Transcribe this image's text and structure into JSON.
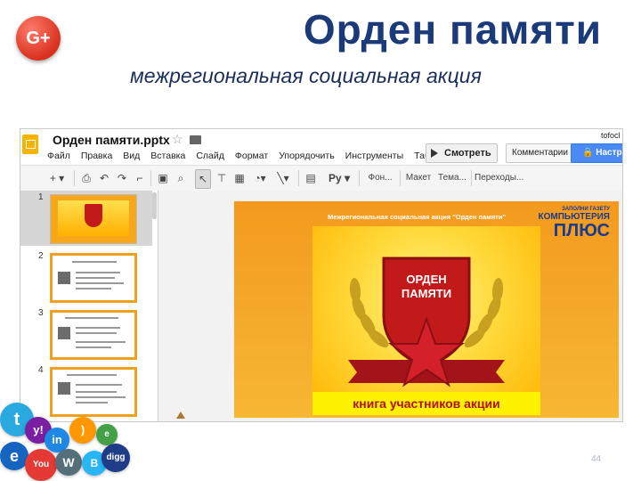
{
  "header": {
    "title": "Орден памяти",
    "subtitle": "межрегиональная социальная акция",
    "gplus_label": "G+"
  },
  "app": {
    "doc_name": "Орден памяти.pptx",
    "user": "tofocl",
    "menu": [
      "Файл",
      "Правка",
      "Вид",
      "Вставка",
      "Слайд",
      "Формат",
      "Упорядочить",
      "Инструменты",
      "Таблица"
    ],
    "buttons": {
      "view": "Смотреть",
      "comments": "Комментарии",
      "share": "Настройки"
    },
    "toolbar": {
      "font_prefix": "Ру",
      "background": "Фон...",
      "layout": "Макет",
      "theme": "Тема...",
      "transition": "Переходы..."
    }
  },
  "thumbnails": [
    {
      "number": "1"
    },
    {
      "number": "2"
    },
    {
      "number": "3"
    },
    {
      "number": "4"
    }
  ],
  "slide": {
    "caption": "Межрегиональная социальная акция \"Орден памяти\"",
    "brand_top": "ЗАПОЛНИ ГАЗЕТУ",
    "brand_a": "КОМПЬЮТЕРИЯ",
    "brand_b": "ПЛЮС",
    "cover_line1": "ОРДЕН",
    "cover_line2": "ПАМЯТИ",
    "cover_footer": "книга участников акции"
  },
  "page_number": "44",
  "colors": {
    "title": "#1a3a7a",
    "slide_orange": "#f39a1e",
    "share_button": "#4a8af4",
    "shield_red": "#c21a1a"
  }
}
